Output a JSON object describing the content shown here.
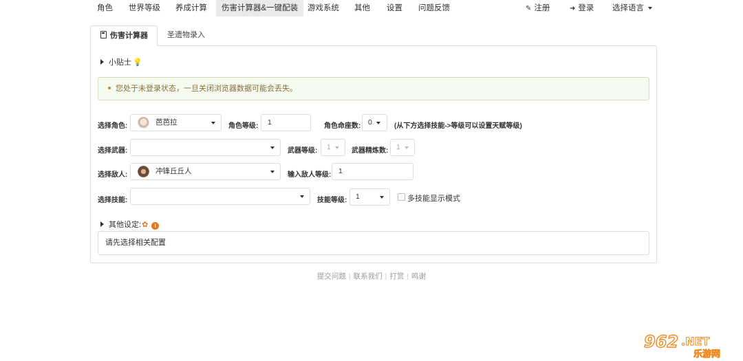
{
  "nav": {
    "items": [
      "角色",
      "世界等级",
      "养成计算",
      "伤害计算器&一键配装",
      "游戏系统",
      "其他",
      "设置",
      "问题反馈"
    ],
    "register": "注册",
    "login": "登录",
    "language": "选择语言"
  },
  "tabs": {
    "active": "伤害计算器",
    "inactive": "圣遗物录入"
  },
  "tips": {
    "label": "小贴士"
  },
  "alert": {
    "text": "您处于未登录状态，一旦关闭浏览器数据可能会丢失。"
  },
  "form": {
    "character_label": "选择角色:",
    "character_value": "芭芭拉",
    "char_level_label": "角色等级:",
    "char_level_value": "1",
    "constellation_label": "角色命座数:",
    "constellation_value": "0",
    "constellation_hint": "(从下方选择技能->等级可以设置天赋等级)",
    "weapon_label": "选择武器:",
    "weapon_value": "",
    "weapon_level_label": "武器等级:",
    "weapon_level_value": "1",
    "refine_label": "武器精炼数:",
    "refine_value": "1",
    "enemy_label": "选择敌人:",
    "enemy_value": "冲锋丘丘人",
    "enemy_level_label": "输入敌人等级:",
    "enemy_level_value": "1",
    "skill_label": "选择技能:",
    "skill_value": "",
    "skill_level_label": "技能等级:",
    "skill_level_value": "1",
    "multi_skill_label": "多技能显示模式"
  },
  "other": {
    "label": "其他设定:"
  },
  "config": {
    "placeholder": "请先选择相关配置"
  },
  "footer": {
    "links": [
      "提交问题",
      "联系我们",
      "打赏",
      "鸣谢"
    ]
  },
  "watermark": {
    "number": "962",
    "suffix": ".NET",
    "cn": "乐游网"
  },
  "colors": {
    "accent_orange": "#e07a1f",
    "alert_bg": "#f6fbef",
    "alert_text": "#8a6d3b"
  }
}
